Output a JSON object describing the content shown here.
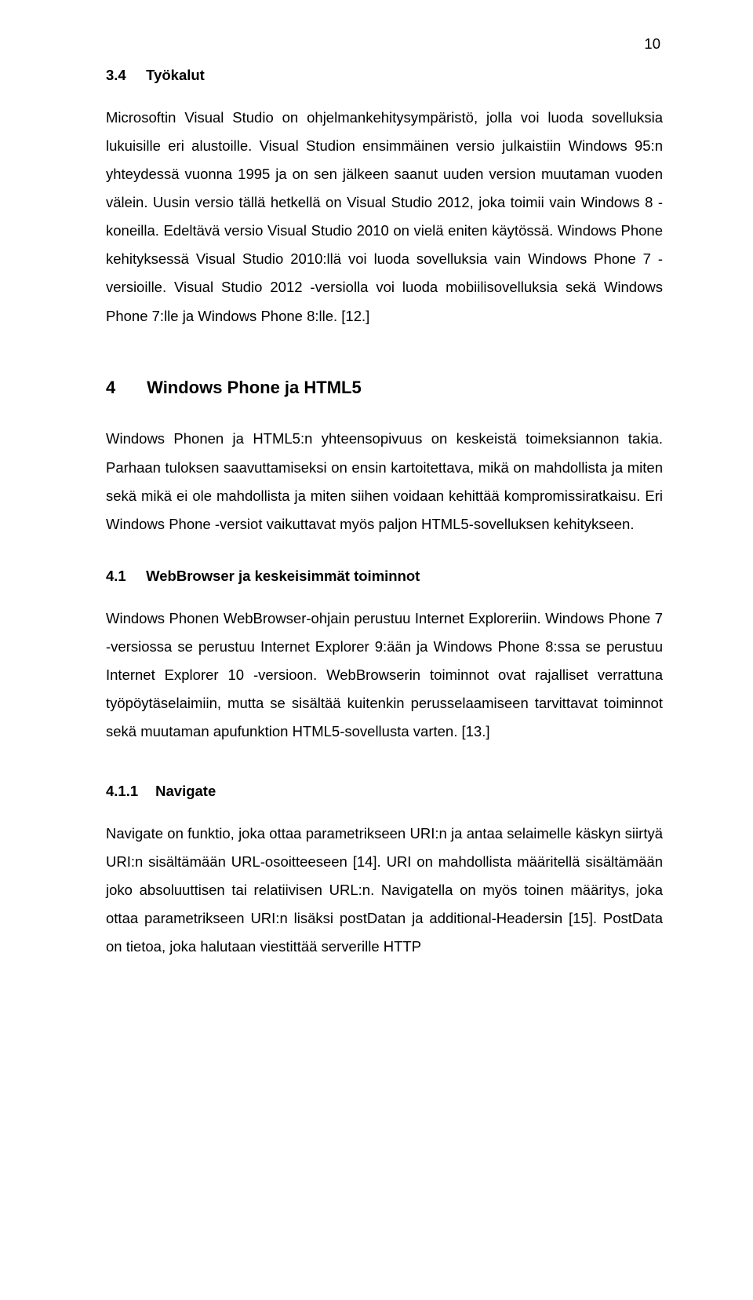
{
  "pageNumber": "10",
  "sections": {
    "s34": {
      "number": "3.4",
      "title": "Työkalut",
      "para": "Microsoftin Visual Studio on ohjelmankehitysympäristö, jolla voi luoda sovelluksia lukuisille eri alustoille. Visual Studion ensimmäinen versio julkaistiin Windows 95:n yhteydessä vuonna 1995 ja on sen jälkeen saanut uuden version muutaman vuoden välein. Uusin versio tällä hetkellä on Visual Studio 2012, joka toimii vain Windows 8 -koneilla. Edeltävä versio Visual Studio 2010 on vielä eniten käytössä. Windows Phone kehityksessä Visual Studio 2010:llä voi luoda sovelluksia vain Windows Phone 7 -versioille. Visual Studio 2012 -versiolla voi luoda mobiilisovelluksia sekä Windows Phone 7:lle ja Windows Phone 8:lle. [12.]"
    },
    "s4": {
      "number": "4",
      "title": "Windows Phone ja HTML5",
      "para": "Windows Phonen ja HTML5:n yhteensopivuus on keskeistä toimeksiannon takia. Parhaan tuloksen saavuttamiseksi on ensin kartoitettava, mikä on mahdollista ja miten sekä mikä ei ole mahdollista ja miten siihen voidaan kehittää kompromissiratkaisu. Eri Windows Phone -versiot vaikuttavat myös paljon HTML5-sovelluksen kehitykseen."
    },
    "s41": {
      "number": "4.1",
      "title": "WebBrowser ja keskeisimmät toiminnot",
      "para": "Windows Phonen WebBrowser-ohjain perustuu Internet Exploreriin. Windows Phone 7 -versiossa se perustuu Internet Explorer 9:ään ja Windows Phone 8:ssa se perustuu Internet Explorer 10 -versioon. WebBrowserin toiminnot ovat rajalliset verrattuna työpöytäselaimiin, mutta se sisältää kuitenkin perusselaamiseen tarvittavat toiminnot sekä muutaman apufunktion HTML5-sovellusta varten. [13.]"
    },
    "s411": {
      "number": "4.1.1",
      "title": "Navigate",
      "para": "Navigate on funktio, joka ottaa parametrikseen URI:n ja antaa selaimelle käskyn siirtyä URI:n sisältämään URL-osoitteeseen [14]. URI on mahdollista määritellä sisältämään joko absoluuttisen tai relatiivisen URL:n. Navigatella on myös toinen määritys, joka ottaa parametrikseen URI:n lisäksi postDatan ja additional-Headersin [15]. PostData on tietoa, joka halutaan viestittää serverille HTTP"
    }
  }
}
